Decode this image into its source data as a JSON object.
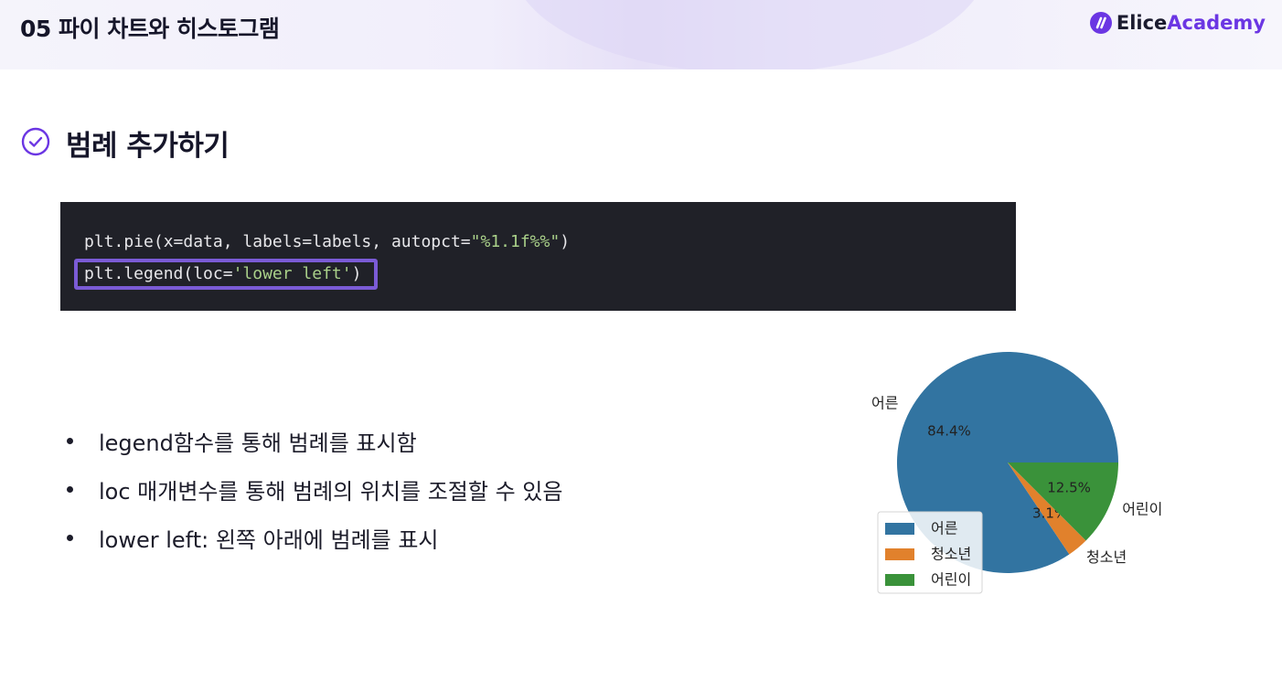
{
  "header": {
    "title": "05 파이 차트와 히스토그램",
    "logo_main": "Elice",
    "logo_accent": "Academy"
  },
  "section": {
    "title": "범례 추가하기"
  },
  "code": {
    "line1_prefix": "plt.pie(x=data, labels=labels, autopct=",
    "line1_string": "\"%1.1f%%\"",
    "line1_suffix": ")",
    "line2_prefix": "plt.legend(loc=",
    "line2_string": "'lower left'",
    "line2_suffix": ")"
  },
  "bullets": [
    "legend함수를 통해 범례를 표시함",
    "loc 매개변수를 통해 범례의 위치를 조절할 수 있음",
    "lower left: 왼쪽 아래에 범례를 표시"
  ],
  "chart_data": {
    "type": "pie",
    "categories": [
      "어른",
      "청소년",
      "어린이"
    ],
    "values": [
      84.4,
      3.1,
      12.5
    ],
    "autopct_labels": [
      "84.4%",
      "3.1%",
      "12.5%"
    ],
    "colors": [
      "#3274a1",
      "#e1812c",
      "#3a923a"
    ],
    "legend": {
      "placement": "lower left",
      "entries": [
        "어른",
        "청소년",
        "어린이"
      ]
    }
  },
  "colors": {
    "accent": "#6b36e3",
    "highlight_border": "#7b5bd6",
    "code_bg": "#202128",
    "code_string": "#a9d089"
  }
}
